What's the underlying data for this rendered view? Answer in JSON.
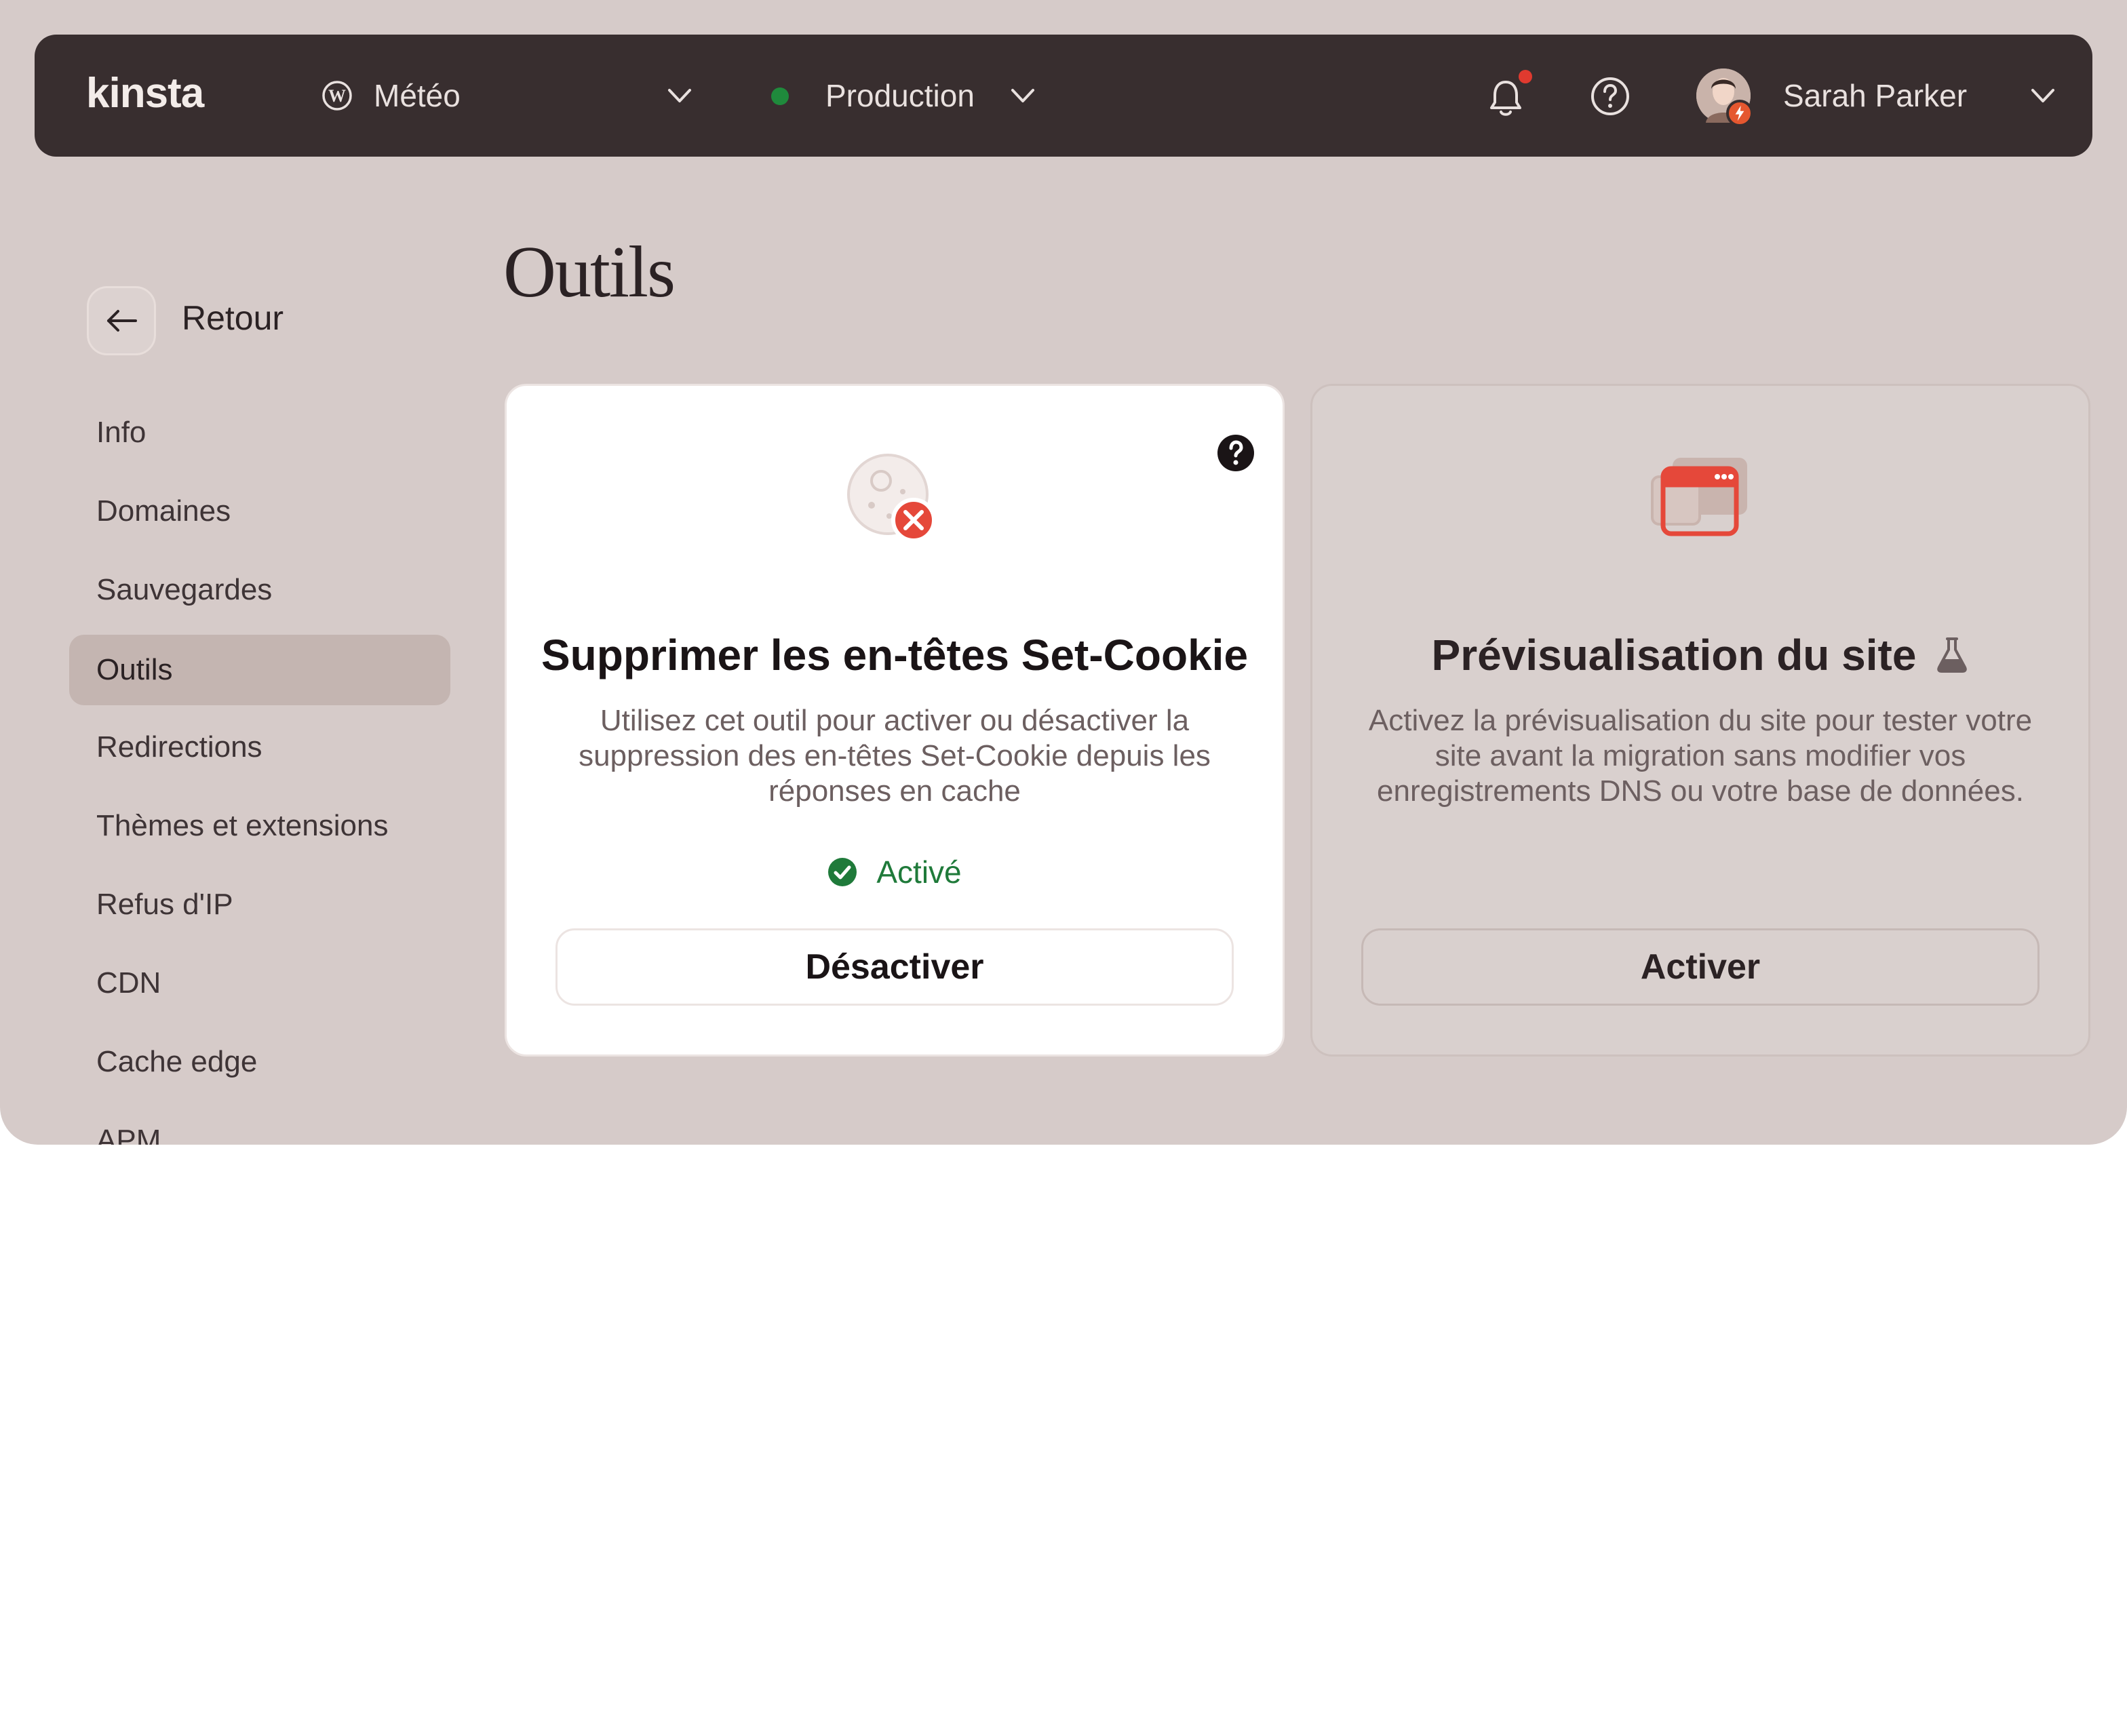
{
  "header": {
    "logo_text": "kinsta",
    "site_name": "Météo",
    "environment": "Production",
    "user_name": "Sarah Parker",
    "environment_status_color": "#1f8a3c",
    "notification_dot_color": "#e03a2f"
  },
  "sidebar": {
    "back_label": "Retour",
    "items": [
      {
        "label": "Info"
      },
      {
        "label": "Domaines"
      },
      {
        "label": "Sauvegardes"
      },
      {
        "label": "Outils",
        "active": true
      },
      {
        "label": "Redirections"
      },
      {
        "label": "Thèmes et extensions"
      },
      {
        "label": "Refus d'IP"
      },
      {
        "label": "CDN"
      },
      {
        "label": "Cache edge"
      },
      {
        "label": "APM"
      }
    ]
  },
  "page": {
    "title": "Outils"
  },
  "cards": [
    {
      "title": "Supprimer les en-têtes Set-Cookie",
      "description": "Utilisez cet outil pour activer ou désactiver la suppression des en-têtes Set-Cookie depuis les réponses en cache",
      "status": "Activé",
      "button": "Désactiver",
      "icon": "cookie-remove-icon"
    },
    {
      "title": "Prévisualisation du site",
      "description": "Activez la prévisualisation du site pour tester votre site avant la migration sans modifier vos enregistrements DNS ou votre base de données.",
      "button": "Activer",
      "icon": "site-preview-icon"
    }
  ],
  "colors": {
    "accent": "#e5483a",
    "status_ok": "#1f7a3a",
    "topbar_bg": "#382e2f",
    "page_bg": "#d6cbc9"
  }
}
